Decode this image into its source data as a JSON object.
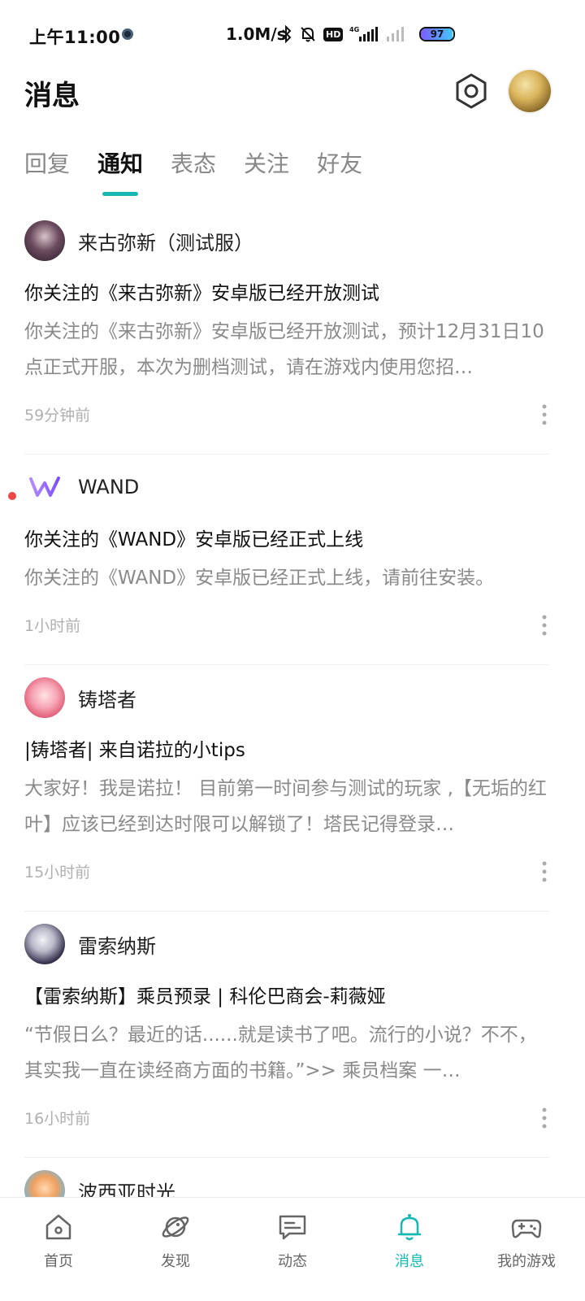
{
  "status_bar": {
    "time": "上午11:00",
    "speed": "1.0M/s",
    "hd": "HD",
    "network": "4G",
    "battery": "97",
    "battery_level": 0.97
  },
  "header": {
    "title": "消息",
    "settings_icon": "settings-hexagon-icon",
    "avatar_icon": "user-avatar"
  },
  "tabs": [
    {
      "label": "回复",
      "active": false
    },
    {
      "label": "通知",
      "active": true
    },
    {
      "label": "表态",
      "active": false
    },
    {
      "label": "关注",
      "active": false
    },
    {
      "label": "好友",
      "active": false
    }
  ],
  "colors": {
    "accent": "#16b8b4",
    "unread": "#f04545",
    "muted": "#8a8a8a"
  },
  "messages": [
    {
      "source": "来古弥新（测试服）",
      "title": "你关注的《来古弥新》安卓版已经开放测试",
      "body": "你关注的《来古弥新》安卓版已经开放测试，预计12月31日10点正式开服，本次为删档测试，请在游戏内使用您招…",
      "time": "59分钟前",
      "unread": false
    },
    {
      "source": "WAND",
      "title": "你关注的《WAND》安卓版已经正式上线",
      "body": "你关注的《WAND》安卓版已经正式上线，请前往安装。",
      "time": "1小时前",
      "unread": true
    },
    {
      "source": "铸塔者",
      "title": "|铸塔者| 来自诺拉的小tips",
      "body": "大家好！我是诺拉！ 目前第一时间参与测试的玩家 ,【无垢的红叶】应该已经到达时限可以解锁了！塔民记得登录…",
      "time": "15小时前",
      "unread": false
    },
    {
      "source": "雷索纳斯",
      "title": "【雷索纳斯】乘员预录 | 科伦巴商会-莉薇娅",
      "body": "“节假日么？最近的话......就是读书了吧。流行的小说？不不，其实我一直在读经商方面的书籍。”>> 乘员档案 一…",
      "time": "16小时前",
      "unread": false
    },
    {
      "source": "波西亚时光",
      "title": "",
      "body": "",
      "time": "",
      "unread": false
    }
  ],
  "bottom_nav": [
    {
      "label": "首页",
      "icon": "home-icon",
      "active": false
    },
    {
      "label": "发现",
      "icon": "planet-icon",
      "active": false
    },
    {
      "label": "动态",
      "icon": "chat-bubble-icon",
      "active": false
    },
    {
      "label": "消息",
      "icon": "bell-icon",
      "active": true
    },
    {
      "label": "我的游戏",
      "icon": "gamepad-icon",
      "active": false
    }
  ]
}
